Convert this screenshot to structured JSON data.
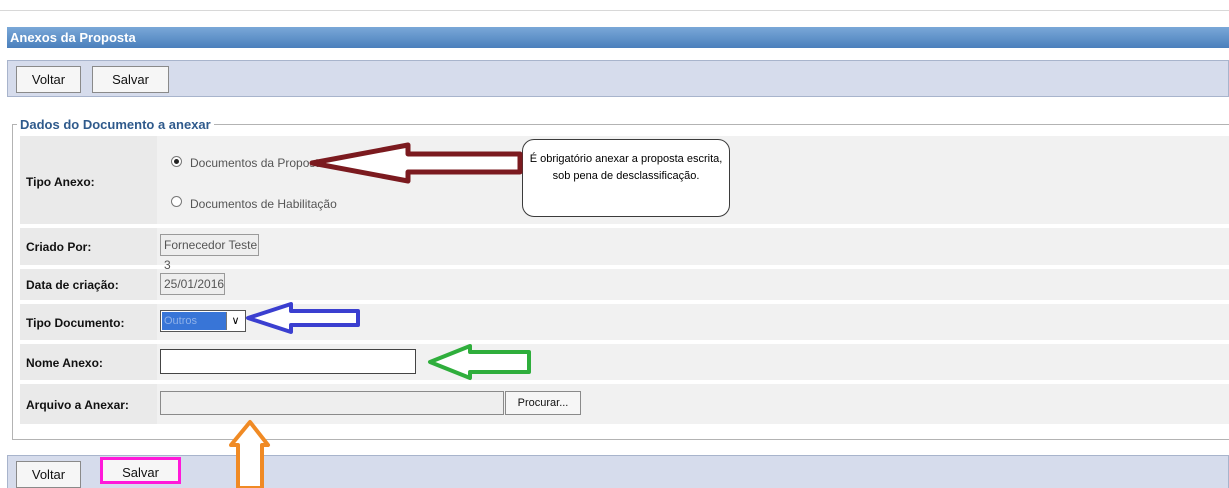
{
  "window": {
    "title": "Anexos da Proposta"
  },
  "toolbar": {
    "voltar_label": "Voltar",
    "salvar_label": "Salvar"
  },
  "fieldset": {
    "legend": "Dados do Documento a anexar"
  },
  "form": {
    "tipo_anexo": {
      "label": "Tipo Anexo:",
      "options": [
        {
          "label": "Documentos da Proposta",
          "selected": true
        },
        {
          "label": "Documentos de Habilitação",
          "selected": false
        }
      ]
    },
    "criado_por": {
      "label": "Criado Por:",
      "value": "Fornecedor Teste 3"
    },
    "data_criacao": {
      "label": "Data de criação:",
      "value": "25/01/2016"
    },
    "tipo_documento": {
      "label": "Tipo Documento:",
      "value": "Outros"
    },
    "nome_anexo": {
      "label": "Nome Anexo:",
      "value": ""
    },
    "arquivo": {
      "label": "Arquivo a Anexar:",
      "value": "",
      "browse_label": "Procurar..."
    }
  },
  "annotation": {
    "callout_line1": "É obrigatório anexar a proposta escrita,",
    "callout_line2": "sob pena de desclassificação.",
    "colors": {
      "dark_red_arrow": "#7b1a1f",
      "blue_arrow": "#3b3fd0",
      "green_arrow": "#2fae3c",
      "orange_arrow": "#f08a24",
      "magenta_highlight": "#ff19d9"
    }
  }
}
